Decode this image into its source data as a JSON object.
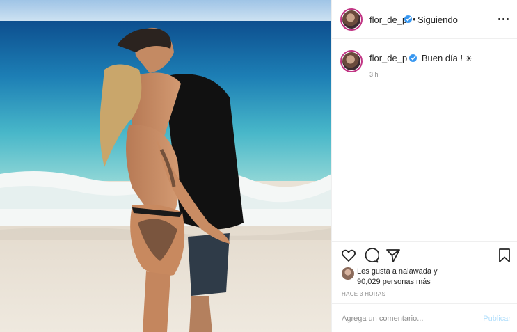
{
  "post": {
    "username": "flor_de_p",
    "separator": "•",
    "follow_status": "Siguiendo",
    "caption": "Buen día !",
    "caption_emoji": "☀",
    "comment_age": "3 h",
    "likes_line1": "Les gusta a naiawada y",
    "likes_line2": "90,029 personas más",
    "posted_ago": "HACE 3 HORAS"
  },
  "comment_box": {
    "placeholder": "Agrega un comentario...",
    "publish_label": "Publicar"
  },
  "icons": {
    "verified": "verified-badge-icon",
    "more": "more-options-icon",
    "like": "heart-icon",
    "comment": "comment-icon",
    "share": "share-icon",
    "save": "bookmark-icon"
  },
  "colors": {
    "verified_blue": "#3897f0",
    "publish_disabled": "#b2dffc",
    "muted_text": "#8e8e8e"
  }
}
